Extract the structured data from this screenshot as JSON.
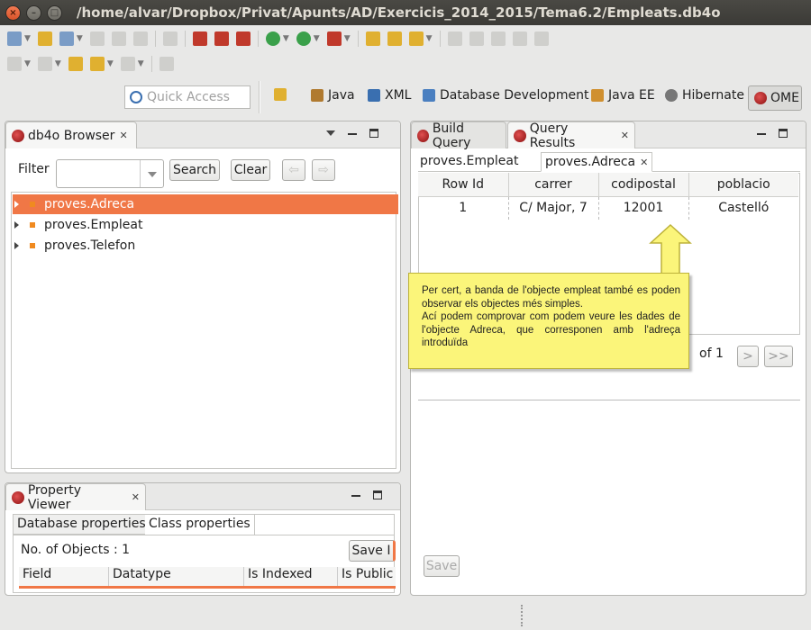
{
  "window": {
    "title": "/home/alvar/Dropbox/Privat/Apunts/AD/Exercicis_2014_2015/Tema6.2/Empleats.db4o",
    "close_glyph": "×",
    "minimize_glyph": "–",
    "maximize_glyph": "□"
  },
  "quick_access": {
    "placeholder": "Quick Access"
  },
  "perspectives": {
    "java": "Java",
    "xml": "XML",
    "database_development": "Database Development",
    "java_ee": "Java EE",
    "hibernate": "Hibernate",
    "ome": "OME"
  },
  "browser": {
    "title": "db4o Browser",
    "filter_label": "Filter",
    "search_button": "Search",
    "clear_button": "Clear",
    "prev_glyph": "⇦",
    "next_glyph": "⇨",
    "items": [
      "proves.Adreca",
      "proves.Empleat",
      "proves.Telefon"
    ]
  },
  "property_viewer": {
    "title": "Property Viewer",
    "tabs": [
      "Database properties",
      "Class properties"
    ],
    "objects_count": "No. of Objects : 1",
    "save_button": "Save I",
    "columns": [
      "Field",
      "Datatype",
      "Is Indexed",
      "Is Public"
    ]
  },
  "query": {
    "tabs": [
      "Build Query",
      "Query Results"
    ],
    "result_tabs": [
      "proves.Empleat",
      "proves.Adreca"
    ],
    "columns": [
      "Row Id",
      "carrer",
      "codipostal",
      "poblacio"
    ],
    "rows": [
      [
        "1",
        "C/ Major, 7",
        "12001",
        "Castelló"
      ]
    ],
    "pagination_text": "of 1",
    "next_page": ">",
    "last_page": ">>",
    "save_button": "Save"
  },
  "callout": {
    "line1": "Per cert, a banda de l'objecte empleat també es poden observar els objectes més simples.",
    "line2": "Ací podem comprovar com podem veure les dades de l'objecte Adreca, que corresponen amb l'adreça introduïda"
  },
  "colors": {
    "selection": "#f07746",
    "callout_bg": "#fbf57a",
    "titlebar": "#3b3a36"
  }
}
